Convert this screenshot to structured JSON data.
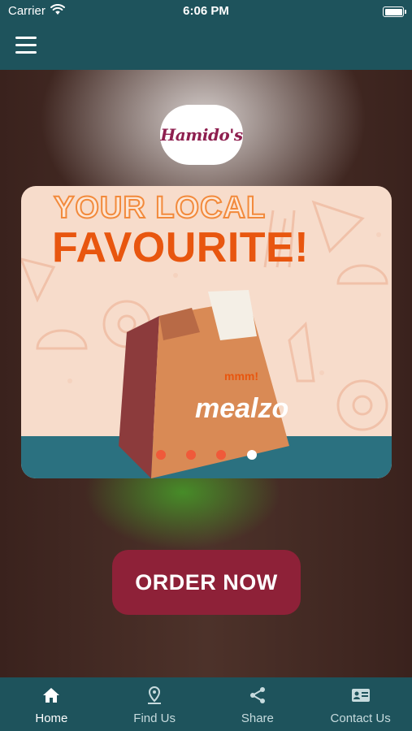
{
  "status_bar": {
    "carrier": "Carrier",
    "time": "6:06 PM"
  },
  "nav_bar": {
    "menu_icon": "hamburger-menu-icon"
  },
  "logo": {
    "text": "Hamido's"
  },
  "banner": {
    "headline_line1": "YOUR LOCAL",
    "headline_line2": "FAVOURITE!",
    "bag_tagline": "mmm!",
    "bag_brand": "mealzo",
    "dots_count": 4,
    "active_dot": 4
  },
  "order_button": {
    "label": "ORDER NOW"
  },
  "tab_bar": {
    "items": [
      {
        "label": "Home",
        "icon": "home-icon",
        "active": true
      },
      {
        "label": "Find Us",
        "icon": "location-pin-icon",
        "active": false
      },
      {
        "label": "Share",
        "icon": "share-icon",
        "active": false
      },
      {
        "label": "Contact Us",
        "icon": "contact-card-icon",
        "active": false
      }
    ]
  },
  "colors": {
    "bar": "#1e535c",
    "button": "#8e2138",
    "accent_orange": "#e8560f",
    "brand": "#8e1f4f"
  }
}
